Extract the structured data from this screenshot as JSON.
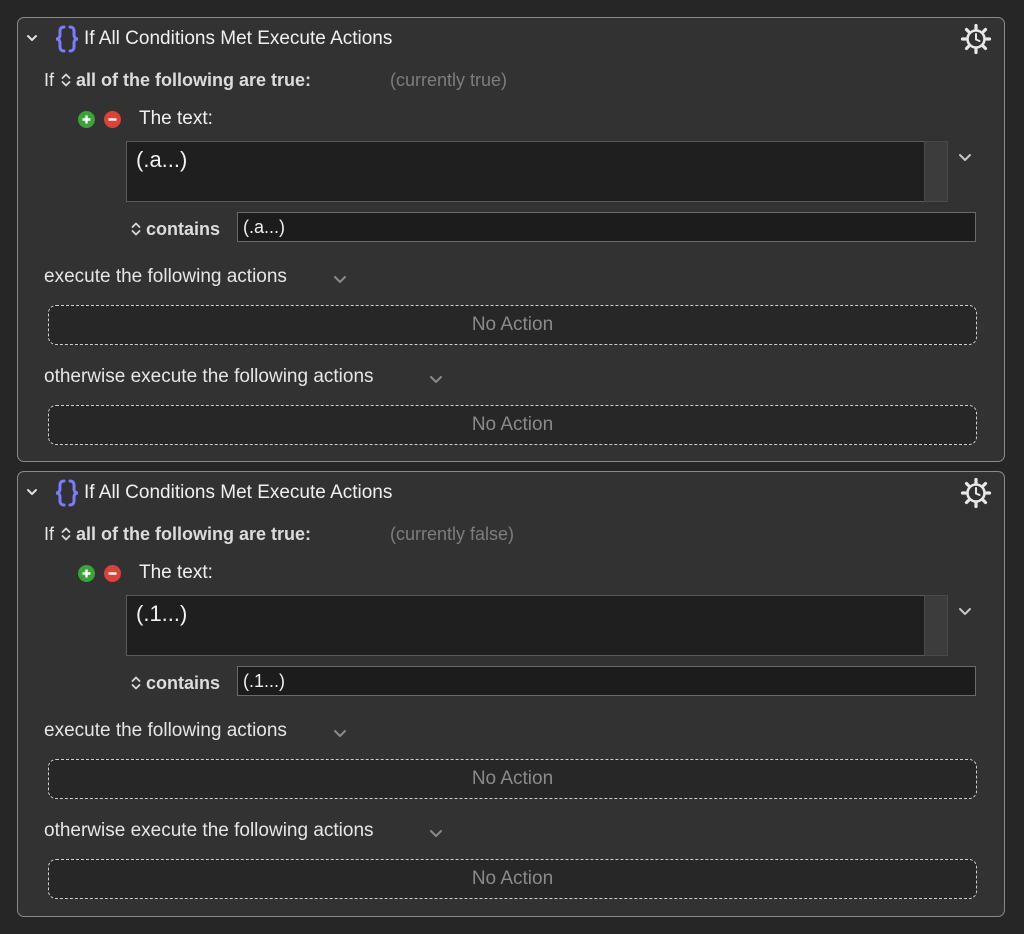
{
  "blocks": [
    {
      "title": "If All Conditions Met Execute Actions",
      "if_label": "If",
      "mode": "all of the following are true:",
      "status": "(currently true)",
      "text_label": "The text:",
      "text_value": "(.a...)",
      "operator": "contains",
      "match_value": "(.a...)",
      "then_label": "execute the following actions",
      "then_placeholder": "No Action",
      "else_label": "otherwise execute the following actions",
      "else_placeholder": "No Action"
    },
    {
      "title": "If All Conditions Met Execute Actions",
      "if_label": "If",
      "mode": "all of the following are true:",
      "status": "(currently false)",
      "text_label": "The text:",
      "text_value": "(.1...)",
      "operator": "contains",
      "match_value": "(.1...)",
      "then_label": "execute the following actions",
      "then_placeholder": "No Action",
      "else_label": "otherwise execute the following actions",
      "else_placeholder": "No Action"
    }
  ],
  "colors": {
    "background": "#262626",
    "panel": "#323232",
    "braces_accent": "#7b7bff",
    "add_green": "#3aa33a",
    "remove_red": "#d9433a"
  },
  "icons": {
    "disclosure": "chevron-down-icon",
    "action_type": "braces-icon",
    "options": "gear-clock-icon",
    "mode_popup": "up-down-icon",
    "add": "plus-icon",
    "remove": "minus-icon",
    "menu": "chevron-down-icon"
  }
}
